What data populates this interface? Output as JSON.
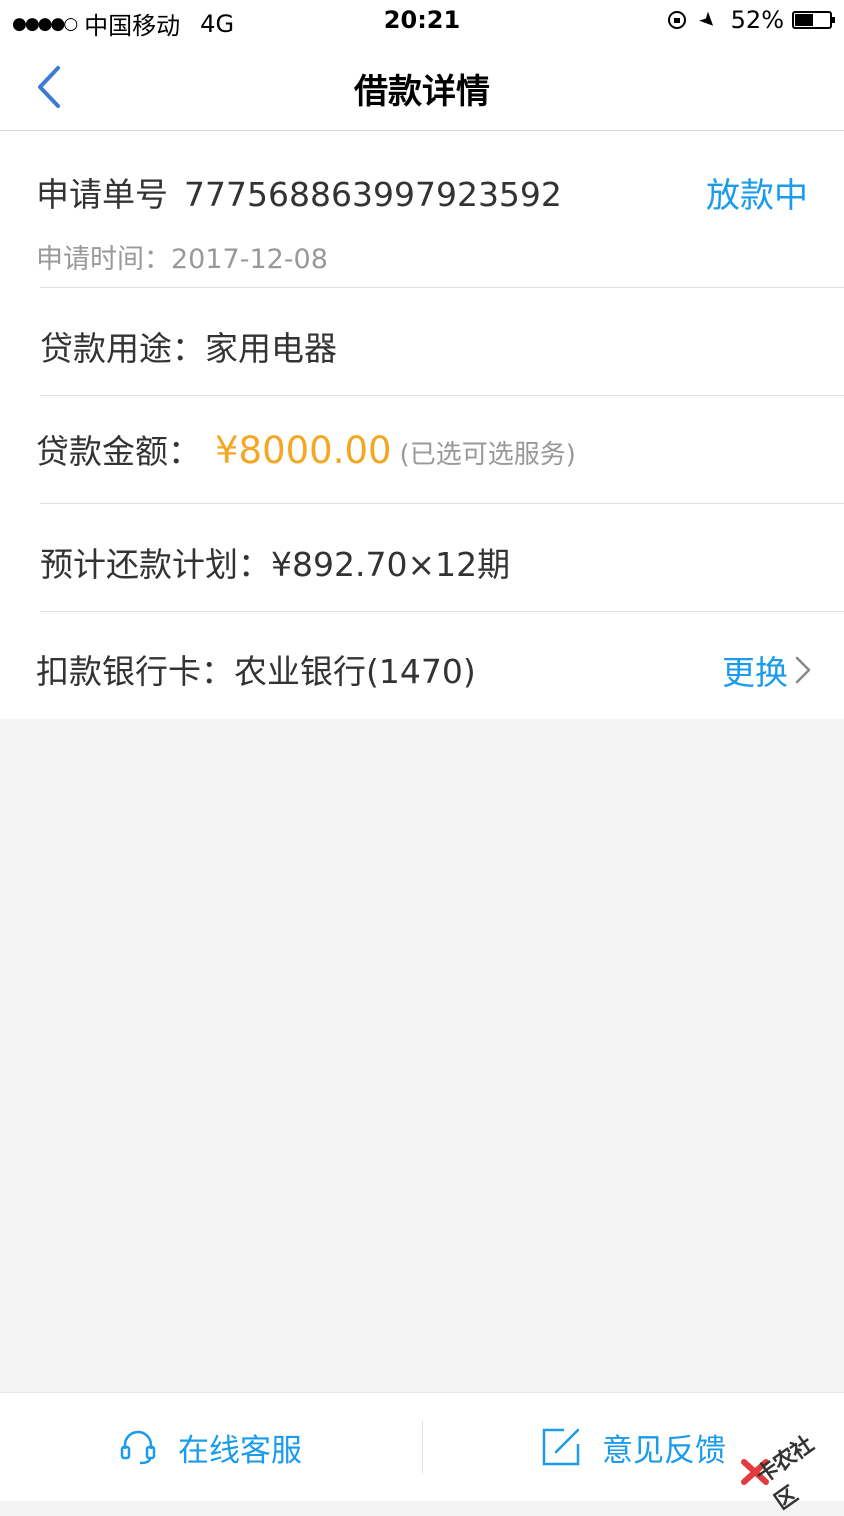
{
  "status_bar": {
    "signal": "●●●●○",
    "carrier": "中国移动",
    "network": "4G",
    "time": "20:21",
    "battery_percent": "52%",
    "battery_level": 0.52
  },
  "nav": {
    "title": "借款详情"
  },
  "detail": {
    "order_label": "申请单号",
    "order_number": "7775688639979235​92",
    "status": "放款中",
    "apply_time_label": "申请时间：",
    "apply_time": "2017-12-08",
    "purpose_label": "贷款用途：",
    "purpose": "家用电器",
    "amount_label": "贷款金额：",
    "amount": "¥8000.00",
    "amount_note": "(已选可选服务)",
    "plan_label": "预计还款计划：",
    "plan": "¥892.70×12期",
    "bank_label": "扣款银行卡：",
    "bank": "农业银行(1470)",
    "change_label": "更换"
  },
  "bottom": {
    "service_label": "在线客服",
    "feedback_label": "意见反馈"
  },
  "watermark": {
    "text": "卡农社区"
  },
  "colors": {
    "accent_blue": "#1a9bec",
    "amount_orange": "#f5a623",
    "background": "#f4f4f4"
  }
}
